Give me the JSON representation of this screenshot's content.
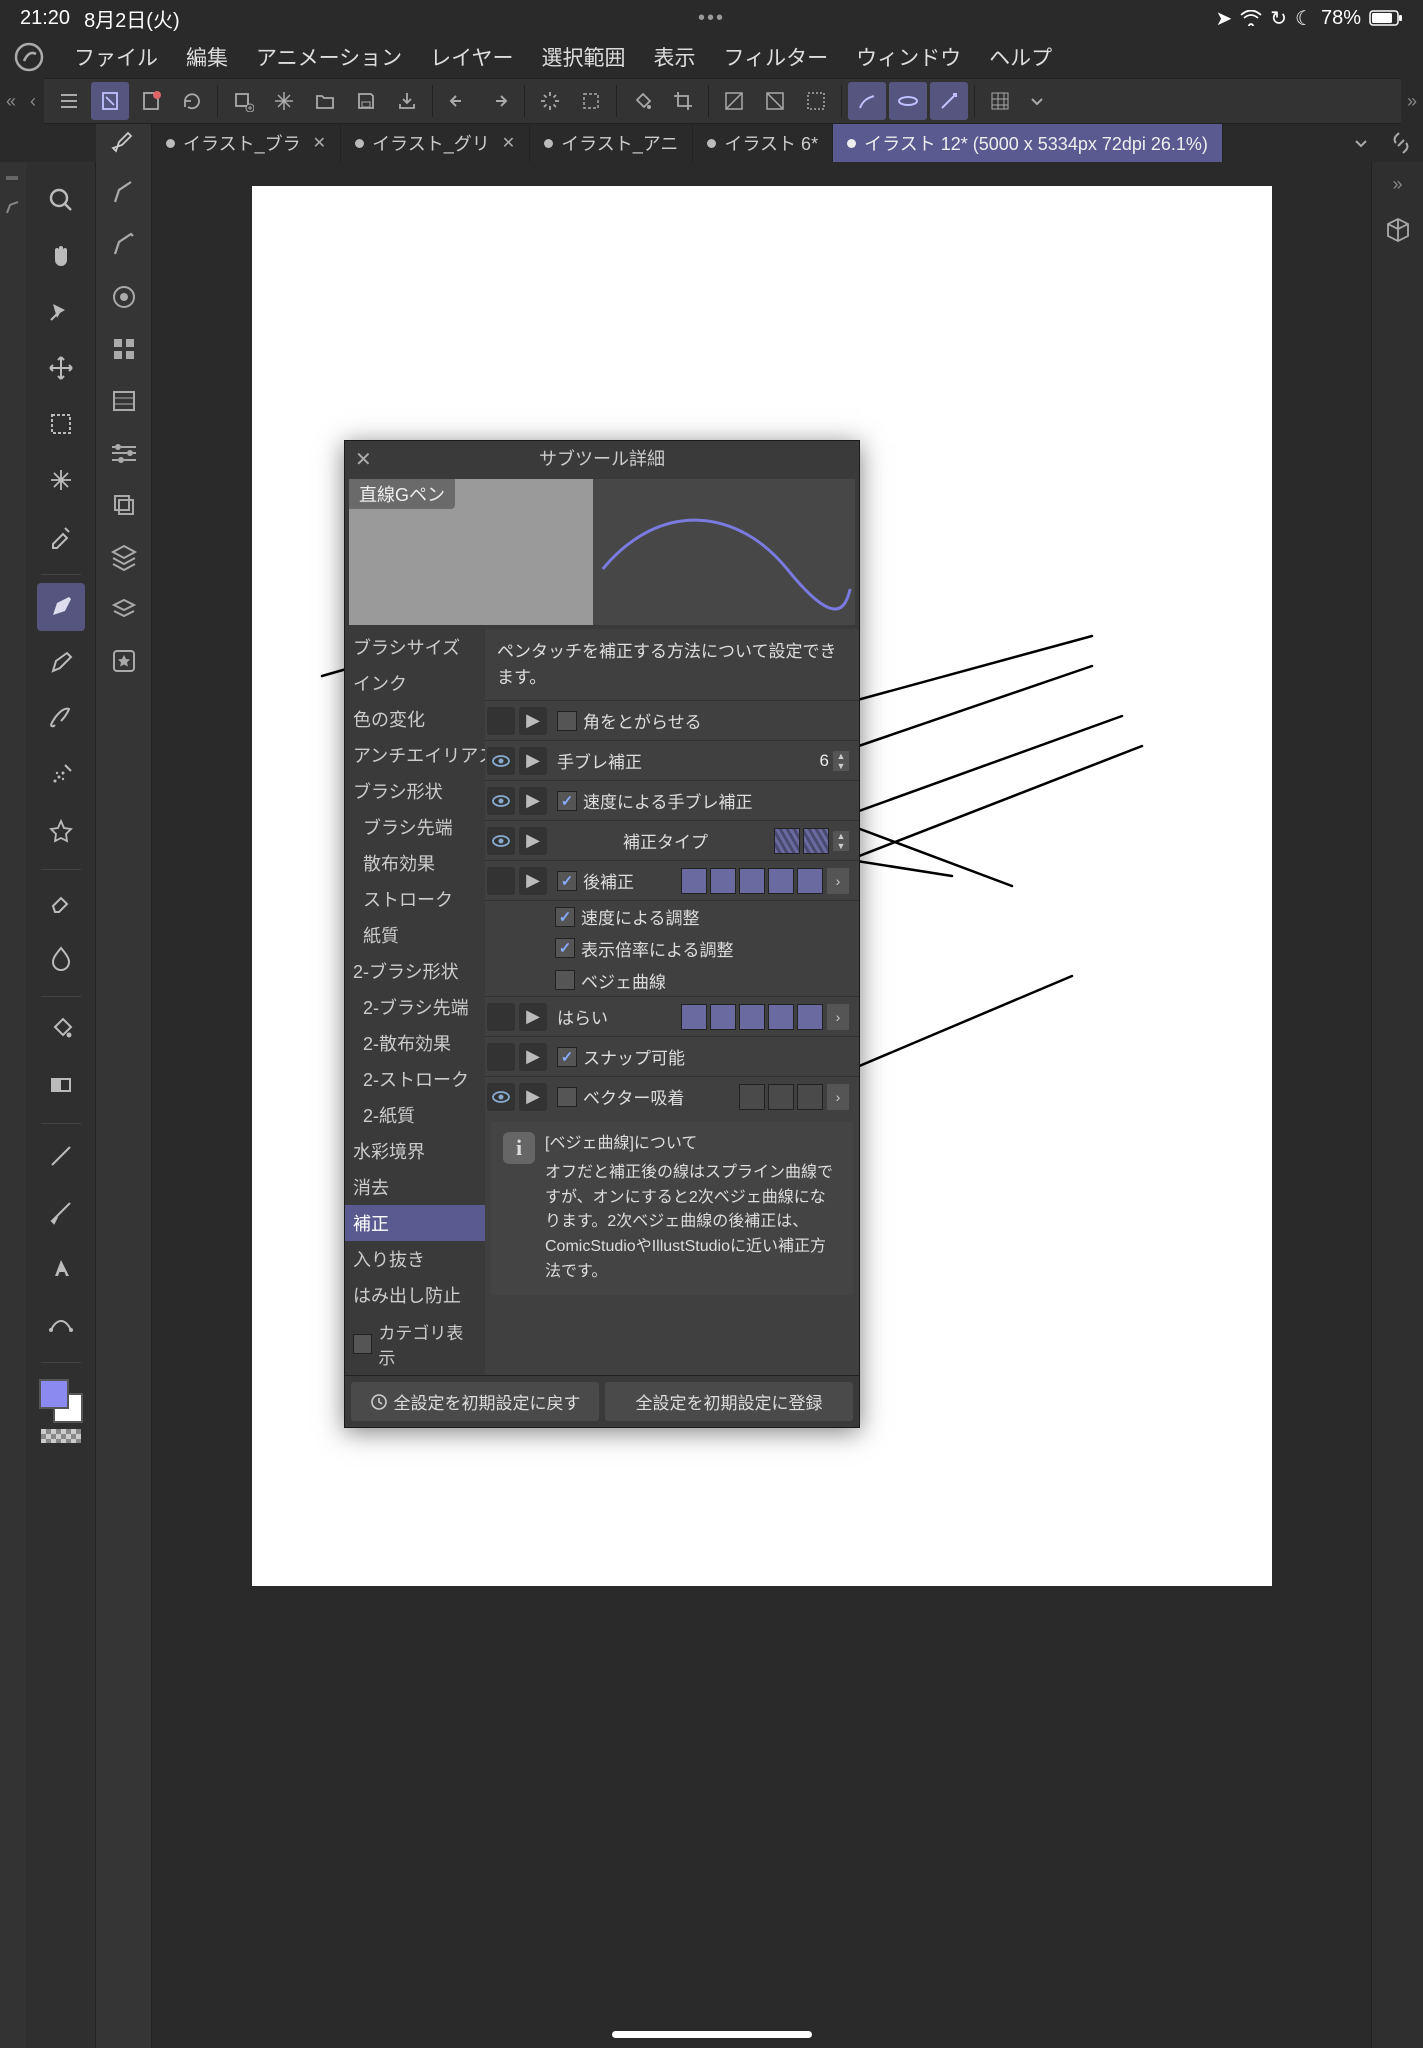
{
  "status": {
    "time": "21:20",
    "date": "8月2日(火)",
    "battery": "78%"
  },
  "menu": {
    "items": [
      "ファイル",
      "編集",
      "アニメーション",
      "レイヤー",
      "選択範囲",
      "表示",
      "フィルター",
      "ウィンドウ",
      "ヘルプ"
    ]
  },
  "tabs": [
    {
      "label": "イラスト_ブラ",
      "close": true
    },
    {
      "label": "イラスト_グリ",
      "close": true
    },
    {
      "label": "イラスト_アニ",
      "close": false
    },
    {
      "label": "イラスト 6*",
      "close": false
    },
    {
      "label": "イラスト 12* (5000 x 5334px 72dpi 26.1%)",
      "close": false,
      "active": true
    }
  ],
  "dialog": {
    "title": "サブツール詳細",
    "brush_name": "直線Gペン",
    "desc": "ペンタッチを補正する方法について設定できます。",
    "categories": [
      "ブラシサイズ",
      "インク",
      "色の変化",
      "アンチエイリアス",
      "ブラシ形状",
      "ブラシ先端",
      "散布効果",
      "ストローク",
      "紙質",
      "2-ブラシ形状",
      "2-ブラシ先端",
      "2-散布効果",
      "2-ストローク",
      "2-紙質",
      "水彩境界",
      "消去",
      "補正",
      "入り抜き",
      "はみ出し防止"
    ],
    "selected_category": "補正",
    "category_footer": "カテゴリ表示",
    "rows": {
      "sharpen_corners": "角をとがらせる",
      "stabilization": "手ブレ補正",
      "stabilization_value": "6",
      "speed_stabilization": "速度による手ブレ補正",
      "correction_type": "補正タイプ",
      "post_correction": "後補正",
      "adjust_by_speed": "速度による調整",
      "adjust_by_zoom": "表示倍率による調整",
      "bezier": "ベジェ曲線",
      "taper": "はらい",
      "snappable": "スナップ可能",
      "vector_magnet": "ベクター吸着"
    },
    "info_title": "[ベジェ曲線]について",
    "info_body": "オフだと補正後の線はスプライン曲線ですが、オンにすると2次ベジェ曲線になります。2次ベジェ曲線の後補正は、ComicStudioやIllustStudioに近い補正方法です。",
    "footer": {
      "reset": "全設定を初期設定に戻す",
      "register": "全設定を初期設定に登録"
    }
  }
}
